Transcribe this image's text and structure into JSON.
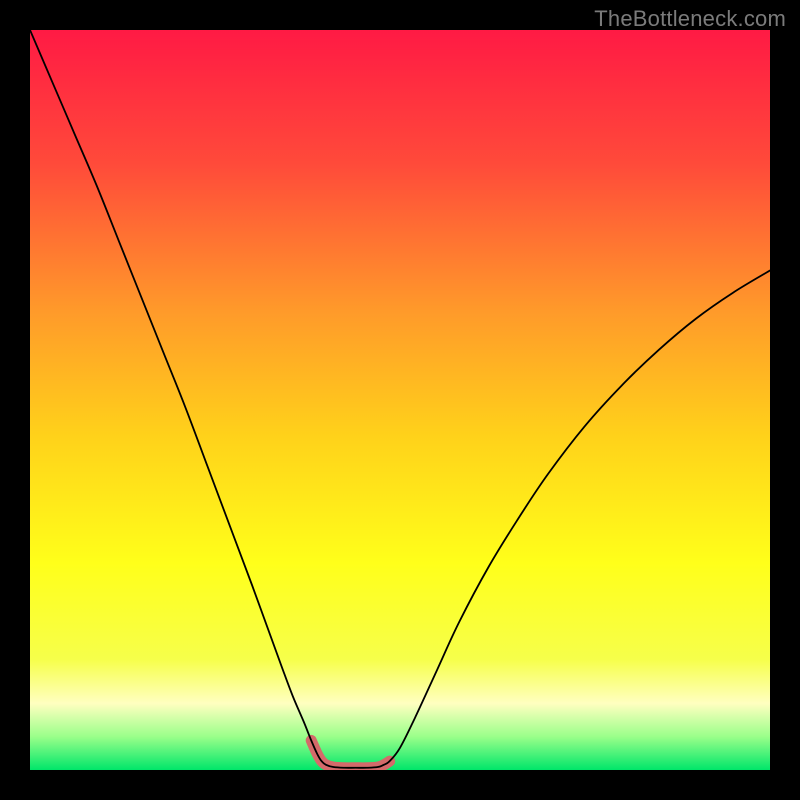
{
  "watermark": "TheBottleneck.com",
  "chart_data": {
    "type": "line",
    "title": "",
    "xlabel": "",
    "ylabel": "",
    "xlim": [
      0,
      100
    ],
    "ylim": [
      0,
      100
    ],
    "grid": false,
    "legend": false,
    "background_gradient": {
      "stops": [
        {
          "offset": 0.0,
          "color": "#ff1a44"
        },
        {
          "offset": 0.18,
          "color": "#ff4a3a"
        },
        {
          "offset": 0.38,
          "color": "#ff9a2a"
        },
        {
          "offset": 0.55,
          "color": "#ffd21a"
        },
        {
          "offset": 0.72,
          "color": "#ffff1a"
        },
        {
          "offset": 0.85,
          "color": "#f6ff4a"
        },
        {
          "offset": 0.91,
          "color": "#ffffc0"
        },
        {
          "offset": 0.955,
          "color": "#9aff8a"
        },
        {
          "offset": 1.0,
          "color": "#00e66a"
        }
      ]
    },
    "series": [
      {
        "name": "bottleneck-curve",
        "stroke": "#000000",
        "stroke_width": 1.8,
        "x": [
          0.0,
          3.0,
          6.0,
          9.0,
          12.0,
          15.0,
          18.0,
          21.0,
          24.0,
          27.0,
          30.0,
          32.0,
          34.0,
          35.5,
          37.0,
          38.0,
          38.8,
          39.4,
          40.0,
          41.0,
          42.5,
          44.0,
          45.5,
          47.0,
          47.8,
          48.6,
          50.0,
          52.0,
          55.0,
          58.0,
          62.0,
          66.0,
          70.0,
          75.0,
          80.0,
          85.0,
          90.0,
          95.0,
          100.0
        ],
        "y": [
          100.0,
          93.0,
          86.0,
          79.0,
          71.5,
          64.0,
          56.5,
          49.0,
          41.0,
          33.0,
          25.0,
          19.5,
          14.0,
          10.0,
          6.5,
          4.0,
          2.2,
          1.2,
          0.7,
          0.4,
          0.3,
          0.3,
          0.3,
          0.4,
          0.7,
          1.2,
          3.0,
          7.0,
          13.5,
          20.0,
          27.5,
          34.0,
          40.0,
          46.5,
          52.0,
          56.8,
          61.0,
          64.5,
          67.5
        ]
      },
      {
        "name": "optimal-zone-overlay",
        "stroke": "#d46a6a",
        "stroke_width": 11,
        "linecap": "round",
        "x": [
          38.0,
          38.8,
          39.4,
          40.0,
          41.0,
          42.5,
          44.0,
          45.5,
          47.0,
          47.8,
          48.6
        ],
        "y": [
          4.0,
          2.2,
          1.2,
          0.7,
          0.4,
          0.3,
          0.3,
          0.3,
          0.4,
          0.7,
          1.2
        ]
      }
    ]
  }
}
